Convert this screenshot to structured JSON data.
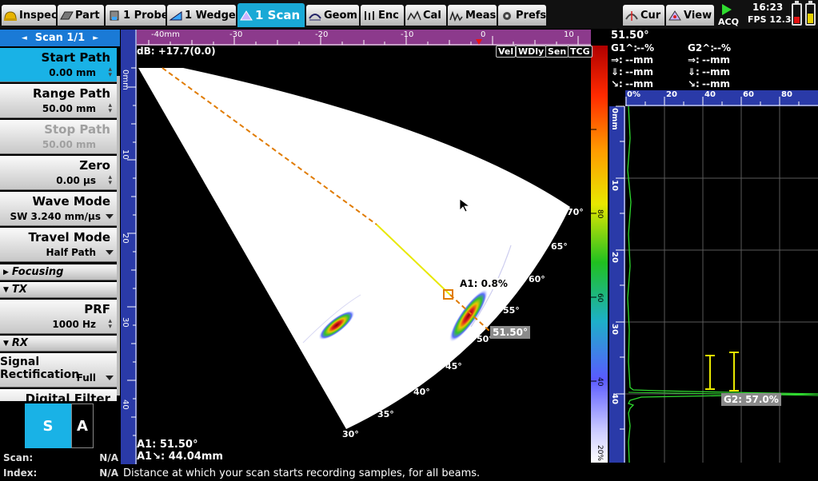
{
  "tabs": [
    {
      "label": "Inspec",
      "icon": "helmet-icon"
    },
    {
      "label": "Part",
      "icon": "part-icon"
    },
    {
      "label": "1 Probe",
      "icon": "probe-icon"
    },
    {
      "label": "1 Wedge",
      "icon": "wedge-icon"
    },
    {
      "label": "1 Scan",
      "icon": "scan-icon",
      "active": true
    },
    {
      "label": "Geom",
      "icon": "geometry-icon"
    },
    {
      "label": "Enc",
      "icon": "encoder-icon"
    },
    {
      "label": "Cal",
      "icon": "calibration-icon"
    },
    {
      "label": "Meas",
      "icon": "measure-icon"
    },
    {
      "label": "Prefs",
      "icon": "preferences-icon"
    }
  ],
  "right_tabs": [
    {
      "label": "Cur",
      "icon": "cursor-icon"
    },
    {
      "label": "View",
      "icon": "view-icon"
    }
  ],
  "status": {
    "acq": "ACQ",
    "time": "16:23",
    "fps": "FPS 12.3"
  },
  "colors": {
    "accent": "#19a9d6",
    "selected_param": "#19b2e6",
    "scan_header": "#1a7ad6",
    "battery_low": "#e11111",
    "battery_mid": "#e8d200",
    "ascan_trace": "#2fdc2f",
    "gate": "#e8e800",
    "scan_line": "#e07b00"
  },
  "scan_header": {
    "label": "Scan 1/1",
    "prev": "◄",
    "next": "►"
  },
  "params": [
    {
      "label": "Start Path",
      "value": "0.00 mm",
      "control": "spin",
      "state": "selected"
    },
    {
      "label": "Range Path",
      "value": "50.00 mm",
      "control": "spin",
      "state": "normal"
    },
    {
      "label": "Stop Path",
      "value": "50.00 mm",
      "control": "spin",
      "state": "disabled"
    },
    {
      "label": "Zero",
      "value": "0.00 µs",
      "control": "spin",
      "state": "normal"
    },
    {
      "label": "Wave Mode",
      "value": "SW 3.240 mm/µs",
      "control": "dropdown",
      "state": "normal"
    },
    {
      "label": "Travel Mode",
      "value": "Half Path",
      "control": "dropdown",
      "state": "normal"
    }
  ],
  "section_focusing": {
    "label": "Focusing",
    "expanded": false
  },
  "section_tx": {
    "label": "TX",
    "expanded": true
  },
  "param_prf": {
    "label": "PRF",
    "value": "1000 Hz",
    "control": "spin"
  },
  "section_rx": {
    "label": "RX",
    "expanded": true
  },
  "param_rectification": {
    "label": "Signal Rectification",
    "value": "Full",
    "control": "dropdown"
  },
  "param_digital_filter": {
    "label": "Digital Filter"
  },
  "view_mode": {
    "s_label": "S",
    "a_label": "A"
  },
  "scan_status": [
    {
      "label": "Scan:",
      "value": "N/A"
    },
    {
      "label": "Index:",
      "value": "N/A"
    }
  ],
  "sector": {
    "db_readout": "dB: +17.7(0.0)",
    "overlay_buttons": [
      "Vel",
      "WDly",
      "Sen",
      "TCG"
    ],
    "h_ticks": [
      "-40mm",
      "-30",
      "-20",
      "-10",
      "0",
      "10"
    ],
    "v_ticks": [
      "0mm",
      "10",
      "20",
      "30",
      "40"
    ],
    "angle_labels": [
      "30°",
      "35°",
      "40°",
      "45°",
      "50°",
      "55°",
      "60°",
      "65°",
      "70°"
    ],
    "cursor_angle": "51.50°",
    "indication_label": "A1: 0.8%",
    "readout_angle": "A1: 51.50°",
    "readout_path": "A1↘: 44.04mm",
    "colorbar_ticks": [
      "80",
      "60",
      "40",
      "20%"
    ]
  },
  "ascan": {
    "beam_angle": "51.50°",
    "readouts": [
      {
        "label": "G1^:",
        "value": "--%"
      },
      {
        "label": "G2^:",
        "value": "--%"
      },
      {
        "label": "⇒:",
        "value": "--mm"
      },
      {
        "label": "⇒:",
        "value": "--mm"
      },
      {
        "label": "⇓:",
        "value": "--mm"
      },
      {
        "label": "⇓:",
        "value": "--mm"
      },
      {
        "label": "↘:",
        "value": "--mm"
      },
      {
        "label": "↘:",
        "value": "--mm"
      }
    ],
    "amp_ticks": [
      "0%",
      "20",
      "40",
      "60",
      "80"
    ],
    "depth_ticks": [
      "0mm",
      "10",
      "20",
      "30",
      "40"
    ],
    "gate_label": "G2: 57.0%"
  },
  "help_text": "Distance at which your scan starts recording samples, for all beams."
}
